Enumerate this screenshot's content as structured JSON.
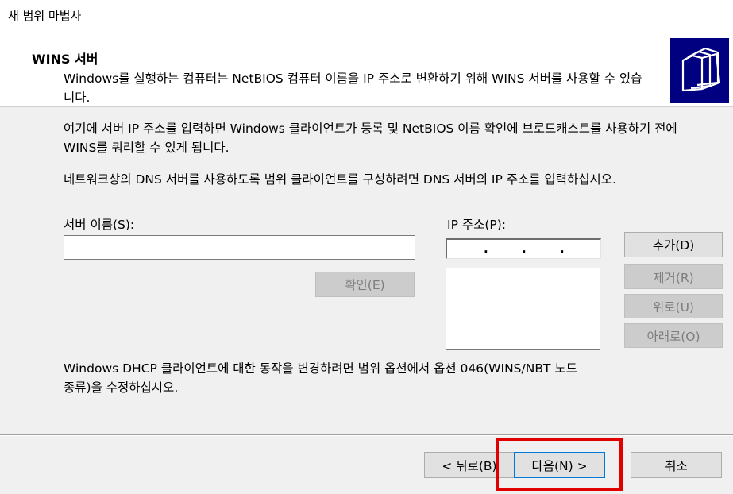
{
  "window": {
    "title": "새 범위 마법사"
  },
  "header": {
    "title": "WINS 서버",
    "description": "Windows를 실행하는 컴퓨터는 NetBIOS 컴퓨터 이름을 IP 주소로 변환하기 위해 WINS 서버를 사용할 수 있습니다.",
    "icon": "folders-icon"
  },
  "body": {
    "paragraph1": "여기에 서버 IP 주소를 입력하면 Windows 클라이언트가 등록 및 NetBIOS 이름 확인에 브로드캐스트를 사용하기 전에 WINS를 쿼리할 수 있게 됩니다.",
    "paragraph2": "네트워크상의 DNS 서버를 사용하도록 범위 클라이언트를 구성하려면 DNS 서버의 IP 주소를 입력하십시오.",
    "server_name_label": "서버 이름(S):",
    "server_name_value": "",
    "ip_label": "IP 주소(P):",
    "ip_value": ". . .",
    "ip_list": [],
    "resolve_button": "확인(E)",
    "add_button": "추가(D)",
    "remove_button": "제거(R)",
    "up_button": "위로(U)",
    "down_button": "아래로(O)",
    "footer_note": "Windows DHCP 클라이언트에 대한 동작을 변경하려면 범위 옵션에서 옵션 046(WINS/NBT 노드 종류)을 수정하십시오."
  },
  "footer": {
    "back_button": "< 뒤로(B)",
    "next_button": "다음(N) >",
    "cancel_button": "취소"
  },
  "colors": {
    "header_icon_bg": "#000080",
    "highlight": "#e10000",
    "focus": "#0078d7"
  }
}
